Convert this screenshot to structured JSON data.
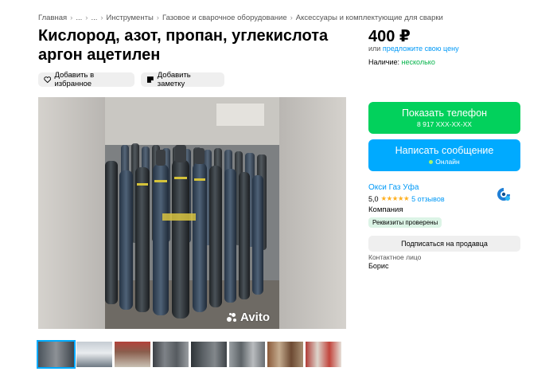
{
  "breadcrumb": {
    "items": [
      "Главная",
      "...",
      "...",
      "Инструменты",
      "Газовое и сварочное оборудование",
      "Аксессуары и комплектующие для сварки"
    ],
    "separator": "›"
  },
  "listing": {
    "title": "Кислород, азот, пропан, углекислота аргон ацетилен",
    "price": "400 ₽",
    "suggest_prefix": "или",
    "suggest_link": "предложите свою цену",
    "availability_label": "Наличие:",
    "availability_value": "несколько",
    "watermark": "Avito"
  },
  "actions": {
    "favorite_label": "Добавить в избранное",
    "note_label": "Добавить заметку"
  },
  "contact": {
    "phone_button_label": "Показать телефон",
    "phone_masked": "8 917 XXX-XX-XX",
    "message_button_label": "Написать сообщение",
    "online_status": "Онлайн",
    "subscribe_label": "Подписаться на продавца",
    "contact_person_label": "Контактное лицо",
    "contact_person_name": "Борис"
  },
  "seller": {
    "name": "Окси Газ Уфа",
    "rating": "5,0",
    "stars": "★★★★★",
    "reviews": "5 отзывов",
    "type": "Компания",
    "verified_badge": "Реквизиты проверены"
  },
  "gallery": {
    "thumbnail_count": 8,
    "active_index": 0
  },
  "colors": {
    "green_button": "#02d15c",
    "blue_button": "#00aaff",
    "link": "#0099f7",
    "star": "#ffb021",
    "available": "#04b34a"
  }
}
